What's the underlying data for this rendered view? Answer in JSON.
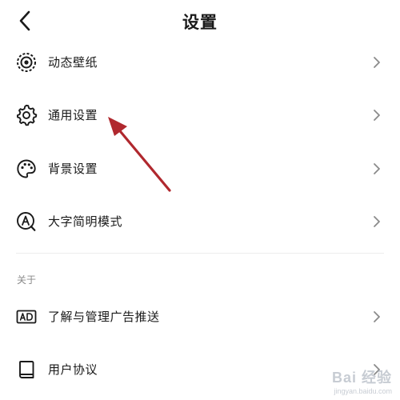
{
  "header": {
    "title": "设置",
    "back_icon": "chevron-left-icon"
  },
  "settings": {
    "items": [
      {
        "label": "动态壁纸",
        "icon": "dynamic-wallpaper-icon"
      },
      {
        "label": "通用设置",
        "icon": "gear-icon"
      },
      {
        "label": "背景设置",
        "icon": "palette-icon"
      },
      {
        "label": "大字简明模式",
        "icon": "large-text-icon"
      }
    ]
  },
  "about": {
    "section_title": "关于",
    "items": [
      {
        "label": "了解与管理广告推送",
        "icon": "ad-icon"
      },
      {
        "label": "用户协议",
        "icon": "book-icon"
      }
    ]
  },
  "annotation": {
    "color": "#b0282e",
    "target": "通用设置"
  },
  "watermark": {
    "brand": "Bai 经验",
    "url": "jingyan.baidu.com"
  }
}
